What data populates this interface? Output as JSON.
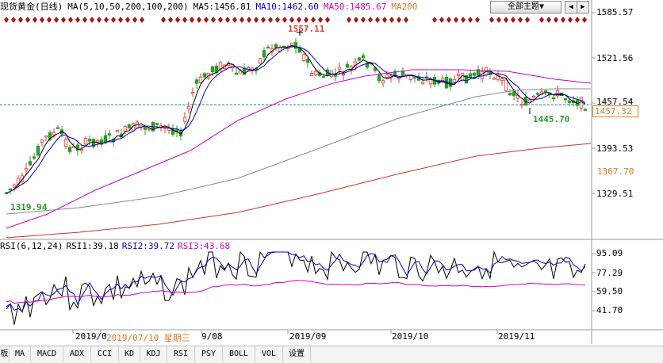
{
  "header": {
    "title": "现货黄金(日线)",
    "ma_param": "MA(5,10,50,200,100,200)",
    "ma5": "MA5:1456.81",
    "ma10": "MA10:1462.60",
    "ma50": "MA50:1485.67",
    "ma200": "MA200",
    "theme_button": "全部主题▼",
    "prev_icon": "◀",
    "next_icon": "▶"
  },
  "price_axis": {
    "ticks": [
      "1585.57",
      "1521.56",
      "1457.54",
      "1393.53",
      "1329.51"
    ],
    "current_price": "1457.32",
    "ma200_value": "1367.70"
  },
  "annotations": {
    "high": "1557.11",
    "low_recent": "1445.70",
    "low_start": "1319.94"
  },
  "rsi": {
    "param": "RSI(6,12,24)",
    "rsi1": "RSI1:39.18",
    "rsi2": "RSI2:39.72",
    "rsi3": "RSI3:43.68",
    "ticks": [
      "95.09",
      "77.29",
      "59.50",
      "41.70"
    ]
  },
  "date_axis": {
    "labels": [
      "2019/0",
      "2019/07/10 星期三",
      "9/08",
      "2019/09",
      "2019/10",
      "2019/11"
    ]
  },
  "tabs": [
    "板",
    "MA",
    "MACD",
    "ADX",
    "CCI",
    "KD",
    "KDJ",
    "RSI",
    "PSY",
    "BOLL",
    "VOL",
    "设置"
  ],
  "colors": {
    "up": "#e8382f",
    "down": "#2a9d2a",
    "ma5": "#000000",
    "ma10": "#0000cc",
    "ma50": "#cc00cc",
    "ma100": "#888888",
    "ma200": "#c0392b",
    "rsi3": "#cc00cc",
    "accent": "#e87722"
  }
}
